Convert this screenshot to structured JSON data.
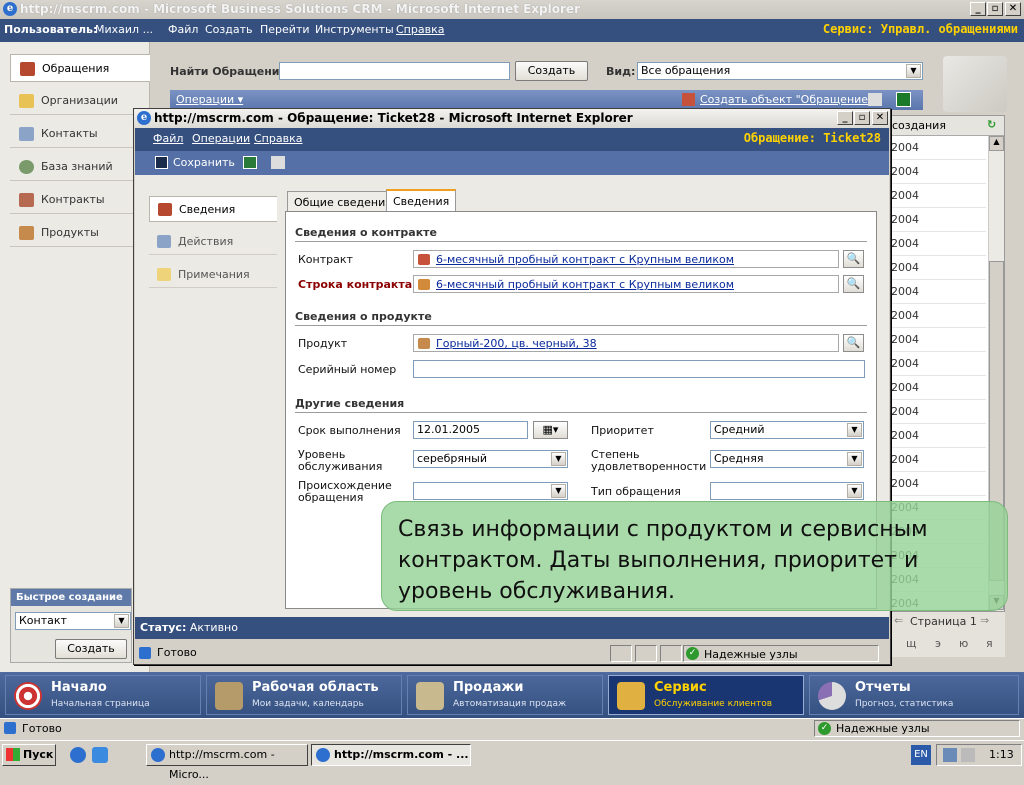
{
  "outer_window": {
    "title": "http://mscrm.com - Microsoft Business Solutions CRM - Microsoft Internet Explorer"
  },
  "crm_header": {
    "user_label": "Пользователь:",
    "user_name": "Михаил ...",
    "menu": [
      "Файл",
      "Создать",
      "Перейти",
      "Инструменты",
      "Справка"
    ],
    "context": "Сервис: Управл. обращениями"
  },
  "left_nav": {
    "items": [
      {
        "label": "Обращения",
        "icon": "case-icon"
      },
      {
        "label": "Организации",
        "icon": "folder-icon"
      },
      {
        "label": "Контакты",
        "icon": "contact-card-icon"
      },
      {
        "label": "База знаний",
        "icon": "magnifier-icon"
      },
      {
        "label": "Контракты",
        "icon": "contract-icon"
      },
      {
        "label": "Продукты",
        "icon": "box-icon"
      }
    ]
  },
  "quick_create": {
    "title": "Быстрое создание",
    "select_value": "Контакт",
    "button": "Создать"
  },
  "main_toolbar": {
    "find_label": "Найти Обращения:",
    "find_value": "",
    "create_button": "Создать",
    "view_label": "Вид:",
    "view_value": "Все обращения",
    "ops_label": "Операции ▾",
    "create_object": "Создать объект \"Обращение\""
  },
  "grid": {
    "header": "создания",
    "rows": [
      "2004",
      "2004",
      "2004",
      "2004",
      "2004",
      "2004",
      "2004",
      "2004",
      "2004",
      "2004",
      "2004",
      "2004",
      "2004",
      "2004",
      "2004",
      "2004",
      "2004",
      "2004",
      "2004",
      "2004"
    ],
    "pager_text": "Страница 1",
    "alphabet": [
      "щ",
      "э",
      "ю",
      "я"
    ]
  },
  "inner_window": {
    "title": "http://mscrm.com - Обращение: Ticket28 - Microsoft Internet Explorer",
    "menu": [
      "Файл",
      "Операции",
      "Справка"
    ],
    "context": "Обращение: Ticket28",
    "save_label": "Сохранить",
    "left_tabs": [
      "Сведения",
      "Действия",
      "Примечания"
    ],
    "form_tabs": [
      "Общие сведения",
      "Сведения"
    ],
    "sections": {
      "contract": "Сведения о контракте",
      "product": "Сведения о продукте",
      "other": "Другие сведения"
    },
    "fields": {
      "contract_label": "Контракт",
      "contract_value": "6-месячный пробный контракт с Крупным великом",
      "contract_line_label": "Строка контракта",
      "contract_line_value": "6-месячный пробный контракт с Крупным великом",
      "product_label": "Продукт",
      "product_value": "Горный-200, цв. черный, 38",
      "serial_label": "Серийный номер",
      "serial_value": "",
      "due_label": "Срок выполнения",
      "due_value": "12.01.2005",
      "priority_label": "Приоритет",
      "priority_value": "Средний",
      "service_level_label": "Уровень обслуживания",
      "service_level_value": "серебряный",
      "satisfaction_label": "Степень удовлетворенности",
      "satisfaction_value": "Средняя",
      "origin_label": "Происхождение обращения",
      "origin_value": "",
      "case_type_label": "Тип обращения",
      "case_type_value": ""
    },
    "status_label": "Статус:",
    "status_value": "Активно",
    "statusbar_text": "Готово",
    "statusbar_zone": "Надежные узлы"
  },
  "overlay_text": "Связь информации с продуктом и сервисным контрактом. Даты выполнения, приоритет и уровень обслуживания.",
  "bottom_nav": [
    {
      "title": "Начало",
      "subtitle": "Начальная страница",
      "icon": "target-icon"
    },
    {
      "title": "Рабочая область",
      "subtitle": "Мои задачи, календарь",
      "icon": "workspace-icon"
    },
    {
      "title": "Продажи",
      "subtitle": "Автоматизация продаж",
      "icon": "sales-icon"
    },
    {
      "title": "Сервис",
      "subtitle": "Обслуживание клиентов",
      "icon": "service-icon"
    },
    {
      "title": "Отчеты",
      "subtitle": "Прогноз, статистика",
      "icon": "reports-icon"
    }
  ],
  "outer_statusbar": {
    "text": "Готово",
    "zone": "Надежные узлы"
  },
  "taskbar": {
    "start": "Пуск",
    "tasks": [
      "http://mscrm.com - Micro...",
      "http://mscrm.com - ..."
    ],
    "lang": "EN",
    "clock": "1:13"
  },
  "colors": {
    "header_blue": "#35507f",
    "accent_yellow": "#ffd200",
    "overlay_green": "#96d296",
    "required_red": "#8b0000"
  }
}
